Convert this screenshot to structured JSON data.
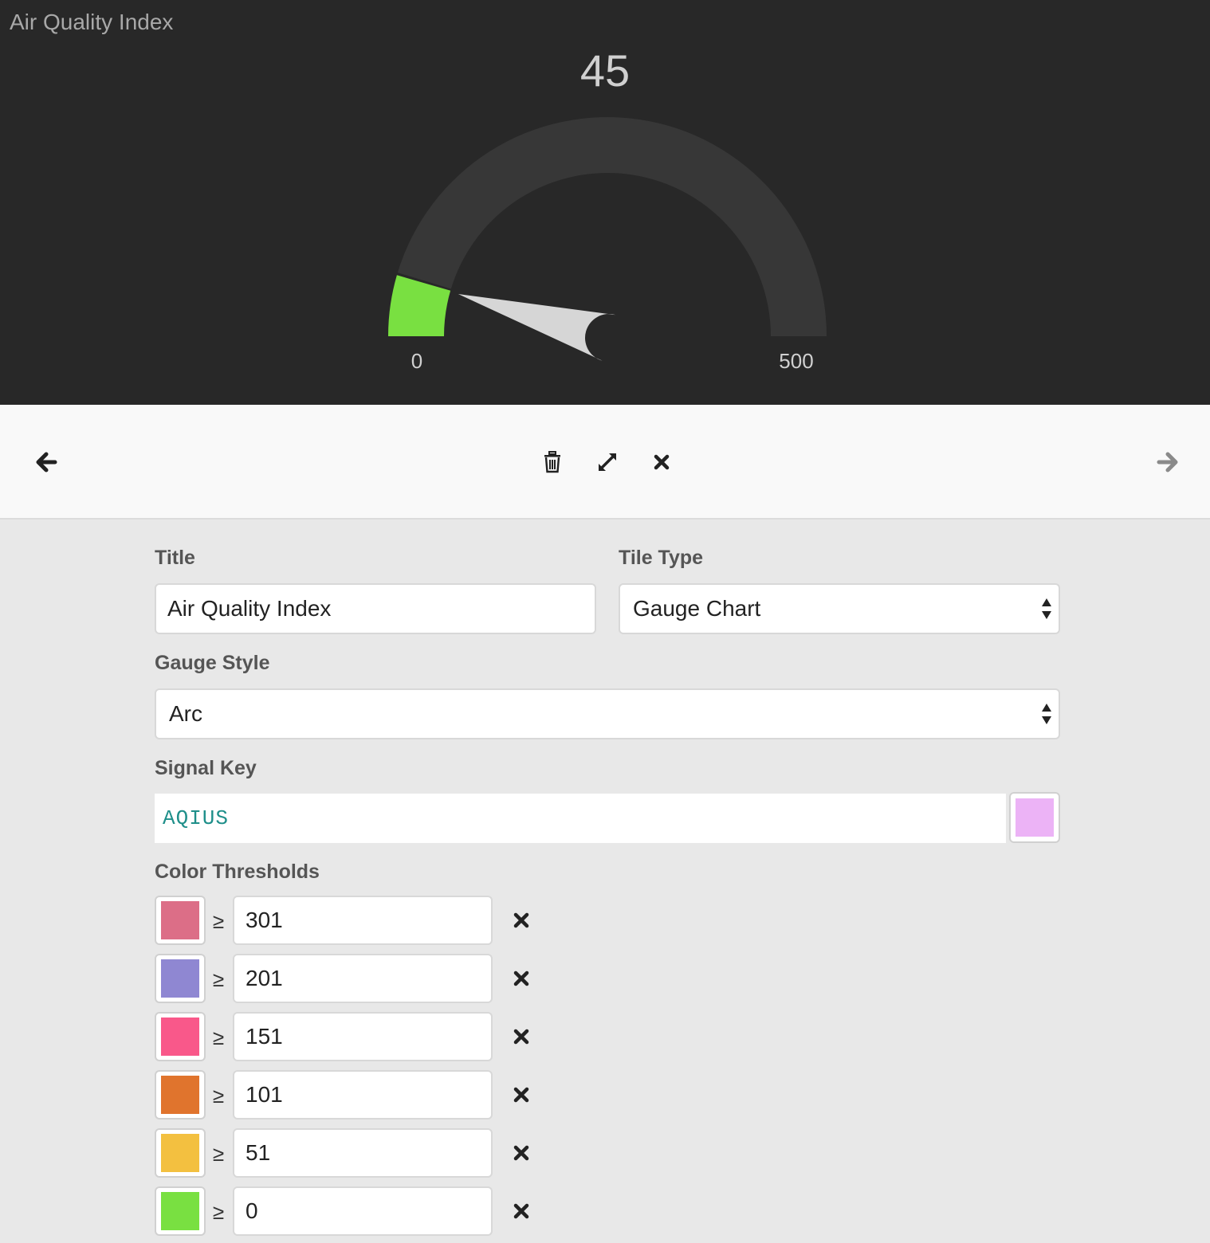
{
  "tile": {
    "title": "Air Quality Index",
    "value": "45",
    "gauge": {
      "min": 0,
      "max": 500,
      "value": 45,
      "min_label": "0",
      "max_label": "500",
      "style": "arc",
      "track_color": "#373737",
      "fill_color": "#79e041",
      "needle_color": "#d6d6d6"
    }
  },
  "toolbar": {
    "back_icon": "arrow-left-icon",
    "delete_icon": "trash-icon",
    "resize_icon": "expand-icon",
    "close_icon": "close-icon",
    "forward_icon": "arrow-right-icon"
  },
  "form": {
    "title_label": "Title",
    "title_value": "Air Quality Index",
    "tile_type_label": "Tile Type",
    "tile_type_value": "Gauge Chart",
    "gauge_style_label": "Gauge Style",
    "gauge_style_value": "Arc",
    "signal_key_label": "Signal Key",
    "signal_key_value": "AQIUS",
    "signal_color": "#ecb3f6",
    "thresholds_label": "Color Thresholds",
    "thresholds": [
      {
        "symbol": "≥",
        "value": "301",
        "color": "#dc6e87"
      },
      {
        "symbol": "≥",
        "value": "201",
        "color": "#8f87d2"
      },
      {
        "symbol": "≥",
        "value": "151",
        "color": "#f9588a"
      },
      {
        "symbol": "≥",
        "value": "101",
        "color": "#e0742d"
      },
      {
        "symbol": "≥",
        "value": "51",
        "color": "#f3c040"
      },
      {
        "symbol": "≥",
        "value": "0",
        "color": "#79e041"
      }
    ]
  }
}
